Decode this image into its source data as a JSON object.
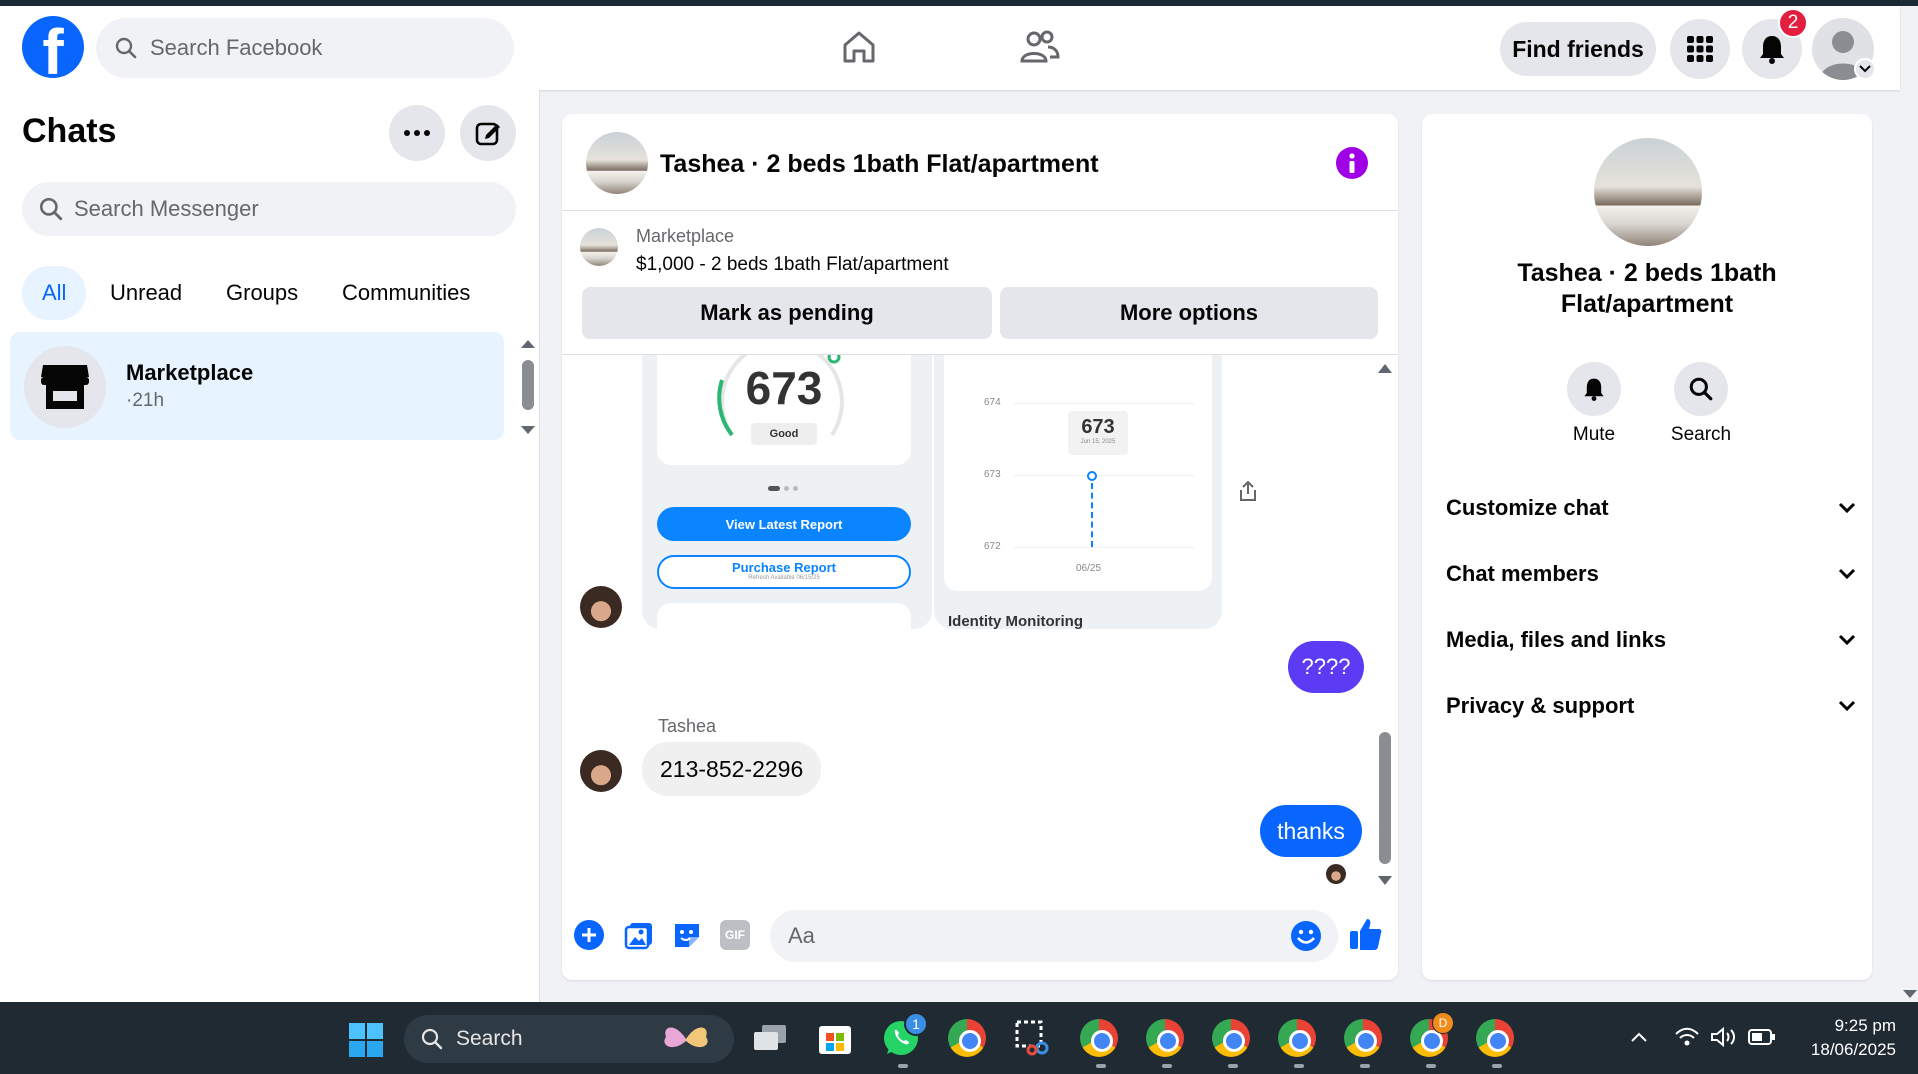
{
  "header": {
    "search_placeholder": "Search Facebook",
    "find_friends": "Find friends",
    "notification_count": "2"
  },
  "sidebar": {
    "title": "Chats",
    "search_placeholder": "Search Messenger",
    "tabs": [
      "All",
      "Unread",
      "Groups",
      "Communities"
    ],
    "chats": [
      {
        "name": "Marketplace",
        "meta": "·21h"
      }
    ]
  },
  "conversation": {
    "title": "Tashea · 2 beds 1bath Flat/apartment",
    "listing": {
      "source": "Marketplace",
      "description": "$1,000 - 2 beds 1bath Flat/apartment",
      "mark_pending": "Mark as pending",
      "more_options": "More options"
    },
    "shared_image": {
      "score": "673",
      "score_label": "Good",
      "view_report": "View Latest Report",
      "purchase_report": "Purchase Report",
      "purchase_sub": "Refresh Available 06/15/25",
      "graph_value": "673",
      "graph_date": "Jun 15, 2025",
      "y_ticks": [
        "674",
        "673",
        "672"
      ],
      "x_tick": "06/25",
      "footer_label": "Identity Monitoring"
    },
    "messages": [
      {
        "direction": "out",
        "text": "????"
      },
      {
        "direction": "in",
        "sender": "Tashea",
        "text": "213-852-2296"
      },
      {
        "direction": "out",
        "text": "thanks"
      }
    ],
    "composer_placeholder": "Aa"
  },
  "details": {
    "title": "Tashea · 2 beds 1bath Flat/apartment",
    "actions": [
      "Mute",
      "Search"
    ],
    "sections": [
      "Customize chat",
      "Chat members",
      "Media, files and links",
      "Privacy & support"
    ]
  },
  "taskbar": {
    "search_label": "Search",
    "whatsapp_badge": "1",
    "chrome_profile_badge": "D",
    "time": "9:25 pm",
    "date": "18/06/2025"
  },
  "colors": {
    "brand_blue": "#0866ff",
    "notification_red": "#e41e3f",
    "info_purple": "#a000e6",
    "outgoing_bubble_purple": "#5b3cf4"
  }
}
